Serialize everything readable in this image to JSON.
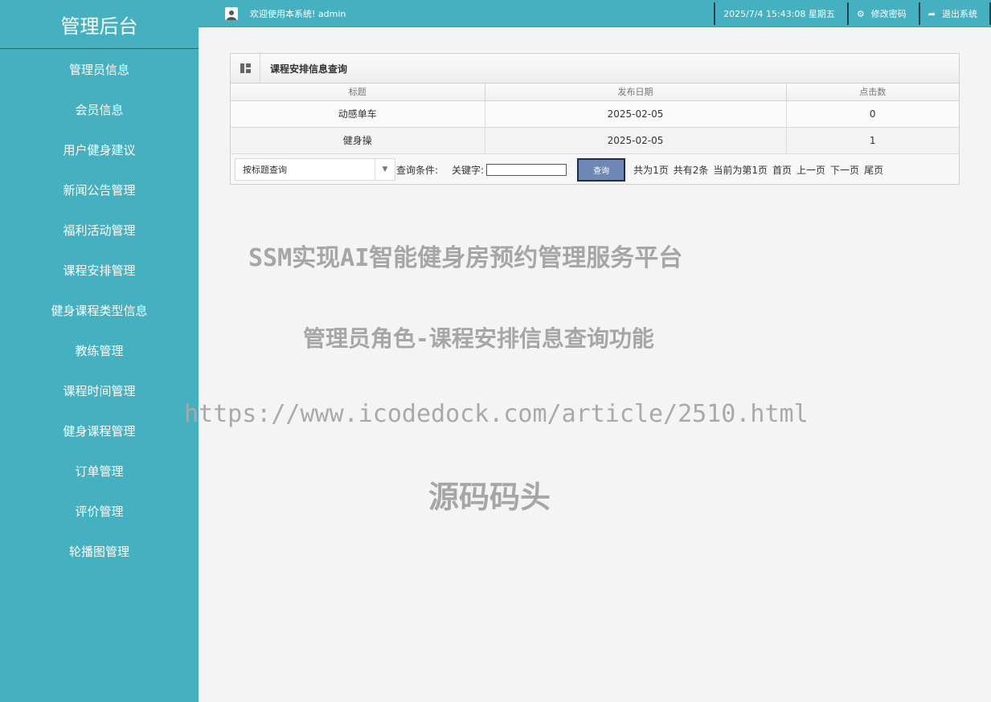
{
  "sidebar": {
    "title": "管理后台",
    "items": [
      {
        "label": "管理员信息"
      },
      {
        "label": "会员信息"
      },
      {
        "label": "用户健身建议"
      },
      {
        "label": "新闻公告管理"
      },
      {
        "label": "福利活动管理"
      },
      {
        "label": "课程安排管理"
      },
      {
        "label": "健身课程类型信息"
      },
      {
        "label": "教练管理"
      },
      {
        "label": "课程时间管理"
      },
      {
        "label": "健身课程管理"
      },
      {
        "label": "订单管理"
      },
      {
        "label": "评价管理"
      },
      {
        "label": "轮播图管理"
      }
    ]
  },
  "topbar": {
    "welcome": "欢迎使用本系统! admin",
    "datetime": "2025/7/4 15:43:08 星期五",
    "change_password": "修改密码",
    "logout": "退出系统"
  },
  "panel": {
    "title": "课程安排信息查询",
    "columns": [
      "标题",
      "发布日期",
      "点击数"
    ],
    "rows": [
      [
        "动感单车",
        "2025-02-05",
        "0"
      ],
      [
        "健身操",
        "2025-02-05",
        "1"
      ]
    ]
  },
  "search": {
    "select_value": "按标题查询",
    "condition_label": "查询条件:",
    "keyword_label": "关键字:",
    "keyword_value": "",
    "button_label": "查询"
  },
  "pager": {
    "total_pages": "共为1页",
    "total_items": "共有2条",
    "current": "当前为第1页",
    "first": "首页",
    "prev": "上一页",
    "next": "下一页",
    "last": "尾页"
  },
  "watermark": {
    "line1": "SSM实现AI智能健身房预约管理服务平台",
    "line2": "管理员角色-课程安排信息查询功能",
    "line3": "https://www.icodedock.com/article/2510.html",
    "line4": "源码码头"
  },
  "colors": {
    "sidebar_bg": "#45b0c0",
    "button_bg": "#6e87b6",
    "page_bg": "#f4f4f4"
  }
}
